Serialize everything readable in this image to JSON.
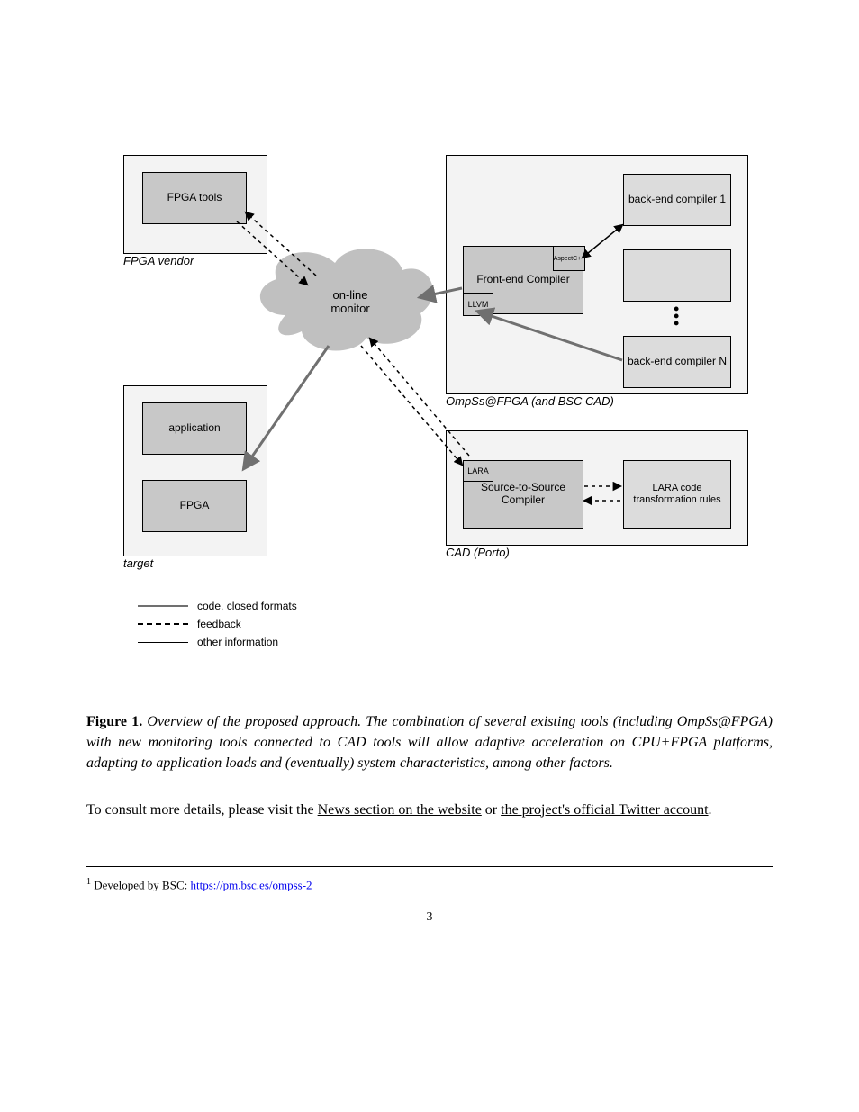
{
  "figure": {
    "panels": {
      "fpga": {
        "label": "FPGA vendor",
        "node": "FPGA tools"
      },
      "target": {
        "label": "target",
        "nodes": {
          "app": "application",
          "fpga": "FPGA"
        }
      },
      "cad": {
        "label": "OmpSs@FPGA (and BSC CAD)",
        "nodes": {
          "front": "Front-end Compiler",
          "be1": "back-end compiler 1",
          "beN": "back-end compiler N"
        },
        "ports": {
          "aspectc": "AspectC++",
          "llvm": "LLVM"
        }
      },
      "lara": {
        "label": "CAD (Porto)",
        "nodes": {
          "s2s": "Source-to-Source Compiler",
          "lara": "LARA code transformation rules"
        },
        "port": "LARA"
      }
    },
    "cloud": "on-line\nmonitor",
    "legend": {
      "solid": "code, closed formats",
      "dashed": "feedback",
      "thin": "other information"
    }
  },
  "caption": {
    "lead": "Figure 1.",
    "text": " Overview of the proposed approach. The combination of several existing tools (including OmpSs@FPGA) with new monitoring tools connected to CAD tools will allow adaptive acceleration on CPU+FPGA platforms, adapting to application loads and (eventually) system characteristics, among other factors."
  },
  "body": {
    "t1": "To consult more details, please visit the ",
    "a1": "News section on the website",
    "t2": " or ",
    "a2": "the project's official Twitter account",
    "t3": "."
  },
  "footnote": {
    "sup": "1",
    "text": "Developed by BSC: ",
    "url": "https://pm.bsc.es/ompss-2"
  },
  "pagenum": "3"
}
